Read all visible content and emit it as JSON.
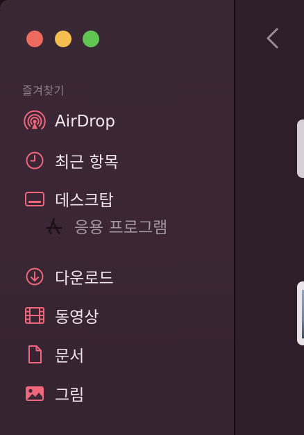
{
  "window": {
    "controls": {
      "close": "close",
      "minimize": "minimize",
      "maximize": "maximize"
    }
  },
  "sidebar": {
    "section_title": "즐겨찾기",
    "items": [
      {
        "id": "airdrop",
        "label": "AirDrop",
        "icon": "airdrop-icon"
      },
      {
        "id": "recents",
        "label": "최근 항목",
        "icon": "clock-icon"
      },
      {
        "id": "desktop",
        "label": "데스크탑",
        "icon": "desktop-icon"
      },
      {
        "id": "applications",
        "label": "응용 프로그램",
        "icon": "app-store-icon",
        "indented": true
      },
      {
        "id": "downloads",
        "label": "다운로드",
        "icon": "download-icon"
      },
      {
        "id": "movies",
        "label": "동영상",
        "icon": "film-icon"
      },
      {
        "id": "documents",
        "label": "문서",
        "icon": "document-icon"
      },
      {
        "id": "pictures",
        "label": "그림",
        "icon": "photo-icon"
      }
    ]
  },
  "toolbar": {
    "back_icon": "chevron-left-icon"
  },
  "colors": {
    "accent": "#f0677c",
    "sidebar_bg": "#3a2734",
    "content_bg": "#2d1e29",
    "section_title": "#8f7f8a",
    "label": "#f0e6ee",
    "close": "#ec6a5e",
    "minimize": "#f4bf4f",
    "maximize": "#61c554"
  }
}
